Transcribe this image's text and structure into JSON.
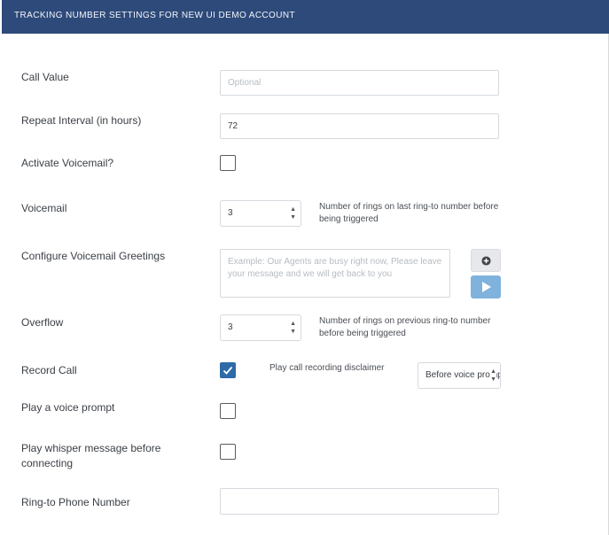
{
  "header": {
    "title": "TRACKING NUMBER SETTINGS FOR NEW UI DEMO ACCOUNT"
  },
  "fields": {
    "call_value": {
      "label": "Call Value",
      "placeholder": "Optional",
      "value": ""
    },
    "repeat_interval": {
      "label": "Repeat Interval (in hours)",
      "value": "72"
    },
    "activate_voicemail": {
      "label": "Activate Voicemail?",
      "checked": false
    },
    "voicemail": {
      "label": "Voicemail",
      "selected": "3",
      "hint": "Number of rings on last ring-to number before being triggered"
    },
    "voicemail_greetings": {
      "label": "Configure Voicemail Greetings",
      "placeholder": "Example: Our Agents are busy right now, Please leave your message and we will get back to you",
      "add_icon": "plus-circle-icon",
      "play_icon": "play-icon"
    },
    "overflow": {
      "label": "Overflow",
      "selected": "3",
      "hint": "Number of rings on previous ring-to number before being triggered"
    },
    "record_call": {
      "label": "Record Call",
      "checked": true,
      "disclaimer_label": "Play call recording disclaimer",
      "disclaimer_selected": "Before voice prompt"
    },
    "voice_prompt": {
      "label": "Play a voice prompt",
      "checked": false
    },
    "whisper_message": {
      "label": "Play whisper message before connecting",
      "checked": false
    },
    "ring_to_number": {
      "label": "Ring-to Phone Number",
      "value": ""
    }
  },
  "colors": {
    "header_bg": "#2e4a7a",
    "checkbox_checked": "#2e6aa7",
    "play_button": "#7fb2dd"
  }
}
